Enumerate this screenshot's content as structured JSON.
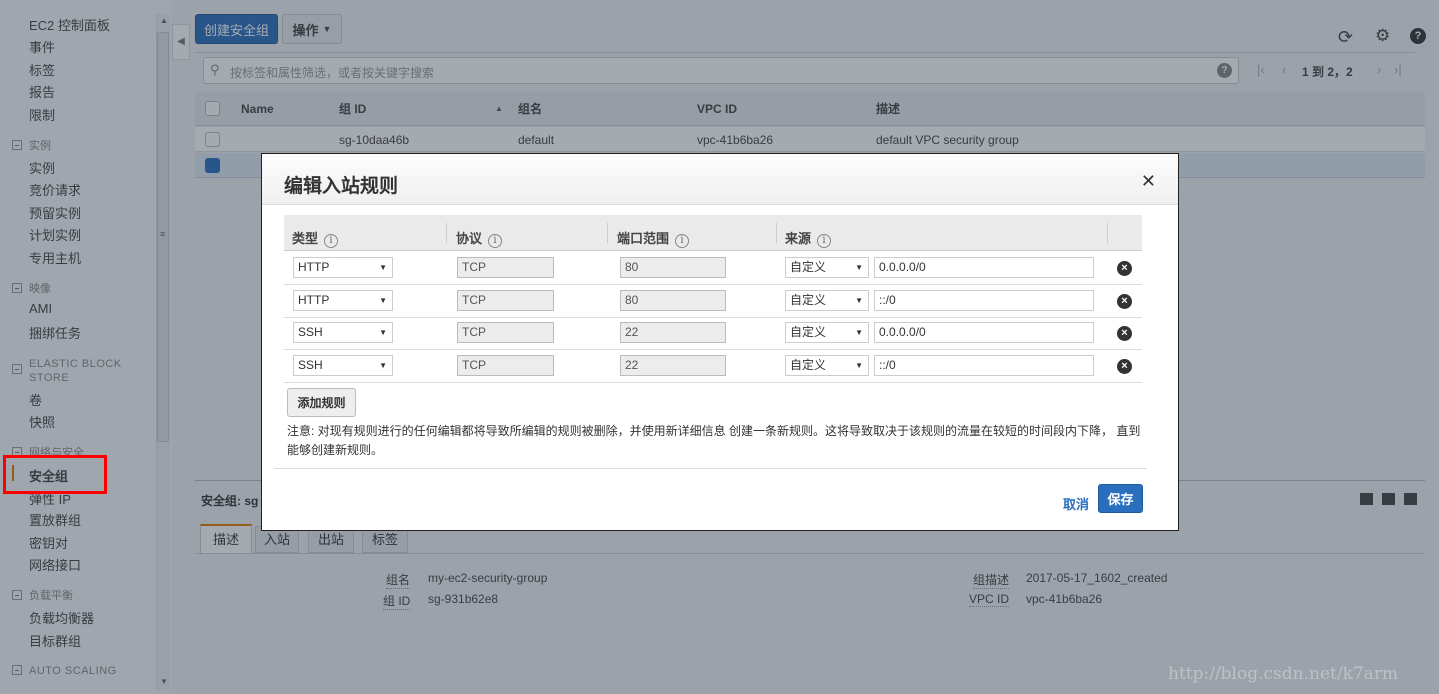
{
  "sidebar": {
    "top_items": [
      "EC2 控制面板",
      "事件",
      "标签",
      "报告",
      "限制"
    ],
    "sections": [
      {
        "title": "实例",
        "items": [
          "实例",
          "竞价请求",
          "预留实例",
          "计划实例",
          "专用主机"
        ]
      },
      {
        "title": "映像",
        "items": [
          "AMI",
          "捆绑任务"
        ]
      },
      {
        "title": "ELASTIC BLOCK STORE",
        "items": [
          "卷",
          "快照"
        ]
      },
      {
        "title": "网络与安全",
        "items": [
          "安全组",
          "弹性 IP",
          "置放群组",
          "密钥对",
          "网络接口"
        ]
      },
      {
        "title": "负载平衡",
        "items": [
          "负载均衡器",
          "目标群组"
        ]
      },
      {
        "title": "AUTO SCALING",
        "items": []
      }
    ],
    "active": "安全组"
  },
  "toolbar": {
    "create_label": "创建安全组",
    "actions_label": "操作"
  },
  "search": {
    "placeholder": "按标签和属性筛选，或者按关键字搜索",
    "pagination": "1 到 2，2"
  },
  "table": {
    "columns": [
      "Name",
      "组 ID",
      "组名",
      "VPC ID",
      "描述"
    ],
    "rows": [
      {
        "name": "",
        "group_id": "sg-10daa46b",
        "group_name": "default",
        "vpc_id": "vpc-41b6ba26",
        "description": "default VPC security group",
        "selected": false
      },
      {
        "selected": true
      }
    ]
  },
  "details": {
    "header": "安全组: sg",
    "tabs": [
      "描述",
      "入站",
      "出站",
      "标签"
    ],
    "active_tab": "描述",
    "fields": [
      {
        "label": "组名",
        "value": "my-ec2-security-group"
      },
      {
        "label": "组 ID",
        "value": "sg-931b62e8"
      },
      {
        "label": "组描述",
        "value": "2017-05-17_1602_created"
      },
      {
        "label": "VPC ID",
        "value": "vpc-41b6ba26"
      }
    ]
  },
  "modal": {
    "title": "编辑入站规则",
    "columns": [
      "类型",
      "协议",
      "端口范围",
      "来源"
    ],
    "rules": [
      {
        "type": "HTTP",
        "protocol": "TCP",
        "port": "80",
        "source_type": "自定义",
        "source": "0.0.0.0/0"
      },
      {
        "type": "HTTP",
        "protocol": "TCP",
        "port": "80",
        "source_type": "自定义",
        "source": "::/0"
      },
      {
        "type": "SSH",
        "protocol": "TCP",
        "port": "22",
        "source_type": "自定义",
        "source": "0.0.0.0/0"
      },
      {
        "type": "SSH",
        "protocol": "TCP",
        "port": "22",
        "source_type": "自定义",
        "source": "::/0"
      }
    ],
    "add_rule_label": "添加规则",
    "note": "注意: 对现有规则进行的任何编辑都将导致所编辑的规则被删除，并使用新详细信息 创建一条新规则。这将导致取决于该规则的流量在较短的时间段内下降， 直到能够创建新规则。",
    "cancel_label": "取消",
    "save_label": "保存"
  },
  "watermark": "http://blog.csdn.net/k7arm",
  "colors": {
    "primary": "#1f6fbf",
    "highlight": "#ff0000",
    "active_bar": "#e07b00"
  }
}
